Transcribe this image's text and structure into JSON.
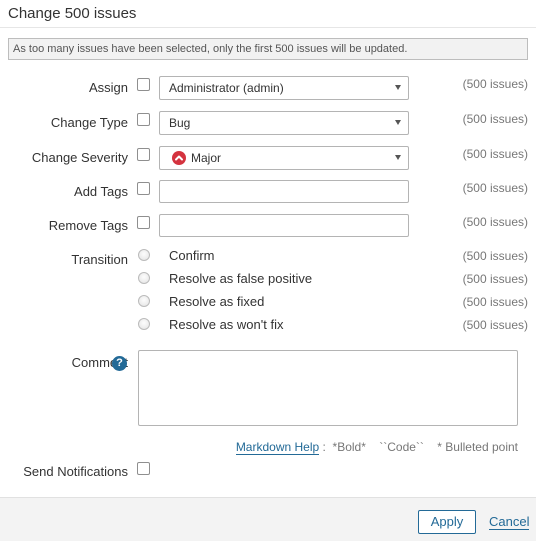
{
  "modal": {
    "title": "Change 500 issues",
    "warning": "As too many issues have been selected, only the first 500 issues will be updated."
  },
  "fields": {
    "assign": {
      "label": "Assign",
      "value": "Administrator (admin)",
      "count": "(500 issues)"
    },
    "change_type": {
      "label": "Change Type",
      "value": "Bug",
      "count": "(500 issues)"
    },
    "change_severity": {
      "label": "Change Severity",
      "value": "Major",
      "icon": "severity-major-icon",
      "icon_color": "#d4333f",
      "count": "(500 issues)"
    },
    "add_tags": {
      "label": "Add Tags",
      "value": "",
      "count": "(500 issues)"
    },
    "remove_tags": {
      "label": "Remove Tags",
      "value": "",
      "count": "(500 issues)"
    }
  },
  "transition": {
    "label": "Transition",
    "options": [
      {
        "label": "Confirm",
        "count": "(500 issues)"
      },
      {
        "label": "Resolve as false positive",
        "count": "(500 issues)"
      },
      {
        "label": "Resolve as fixed",
        "count": "(500 issues)"
      },
      {
        "label": "Resolve as won't fix",
        "count": "(500 issues)"
      }
    ]
  },
  "comment": {
    "label": "Comment",
    "help_icon": "question-circle-icon",
    "value": ""
  },
  "markdown": {
    "help_link": "Markdown Help",
    "separator": ":",
    "bold": "*Bold*",
    "code": "``Code``",
    "bullet": "* Bulleted point"
  },
  "notifications": {
    "label": "Send Notifications"
  },
  "footer": {
    "apply": "Apply",
    "cancel": "Cancel"
  },
  "colors": {
    "accent": "#236a97",
    "severity_major": "#d4333f"
  }
}
